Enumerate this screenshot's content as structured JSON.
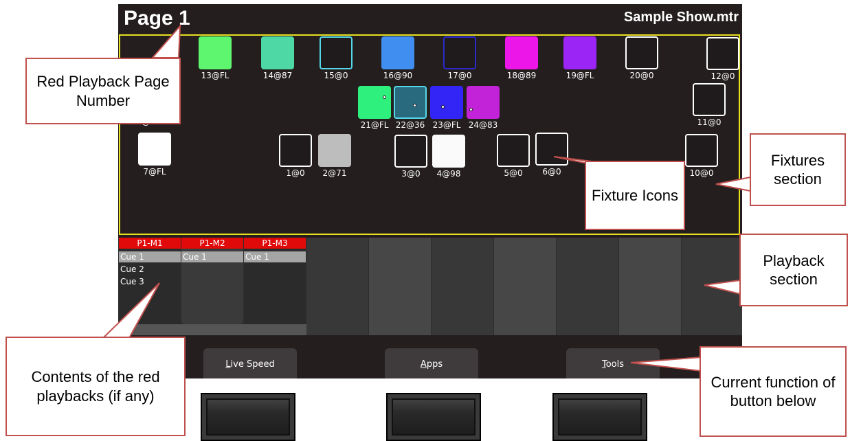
{
  "header": {
    "page_title": "Page 1",
    "show_name": "Sample Show.mtr"
  },
  "fixtures": [
    {
      "label": "13@FL",
      "color": "#5ef56f",
      "outline": false
    },
    {
      "label": "14@87",
      "color": "#4ed8a6",
      "outline": false
    },
    {
      "label": "15@0",
      "color": "#1f1b1c",
      "outline": true,
      "border": "#55d8e8"
    },
    {
      "label": "16@90",
      "color": "#3f8ef0",
      "outline": false
    },
    {
      "label": "17@0",
      "color": "#1f1b1c",
      "outline": true,
      "border": "#2a2acc"
    },
    {
      "label": "18@89",
      "color": "#ec16e8",
      "outline": false
    },
    {
      "label": "19@FL",
      "color": "#9a25f5",
      "outline": false
    },
    {
      "label": "20@0",
      "color": "#1f1b1c",
      "outline": true,
      "border": "#ffffff"
    },
    {
      "label": "12@0",
      "color": "#1f1b1c",
      "outline": true,
      "border": "#ffffff"
    },
    {
      "label": "8@0",
      "color": "#1f1b1c",
      "outline": true,
      "border": "#ffffff"
    },
    {
      "label": "21@FL",
      "color": "#2ef07d",
      "outline": false
    },
    {
      "label": "22@36",
      "color": "#2a6a7e",
      "outline": true,
      "border": "#55d8e8"
    },
    {
      "label": "23@FL",
      "color": "#3325f5",
      "outline": false
    },
    {
      "label": "24@83",
      "color": "#c222d8",
      "outline": false
    },
    {
      "label": "11@0",
      "color": "#1f1b1c",
      "outline": true,
      "border": "#ffffff"
    },
    {
      "label": "7@FL",
      "color": "#ffffff",
      "outline": false
    },
    {
      "label": "1@0",
      "color": "#1f1b1c",
      "outline": true,
      "border": "#ffffff"
    },
    {
      "label": "2@71",
      "color": "#bdbdbd",
      "outline": false
    },
    {
      "label": "3@0",
      "color": "#1f1b1c",
      "outline": true,
      "border": "#ffffff"
    },
    {
      "label": "4@98",
      "color": "#fafafa",
      "outline": false
    },
    {
      "label": "5@0",
      "color": "#1f1b1c",
      "outline": true,
      "border": "#ffffff"
    },
    {
      "label": "6@0",
      "color": "#1f1b1c",
      "outline": true,
      "border": "#ffffff"
    },
    {
      "label": "10@0",
      "color": "#1f1b1c",
      "outline": true,
      "border": "#ffffff"
    }
  ],
  "playbacks": [
    {
      "name": "P1-M1",
      "cues": [
        "Cue 1",
        "Cue 2",
        "Cue 3"
      ]
    },
    {
      "name": "P1-M2",
      "cues": [
        "Cue 1"
      ]
    },
    {
      "name": "P1-M3",
      "cues": [
        "Cue 1"
      ]
    }
  ],
  "softkeys": [
    {
      "label": "Live Speed",
      "underline": "L",
      "rest": "ive Speed"
    },
    {
      "label": "Apps",
      "underline": "A",
      "rest": "pps"
    },
    {
      "label": "Tools",
      "underline": "T",
      "rest": "ools"
    }
  ],
  "callouts": {
    "page_number": "Red Playback Page Number",
    "fixture_icons": "Fixture Icons",
    "fixtures_section": "Fixtures section",
    "playback_section": "Playback section",
    "red_playback_contents": "Contents of the red playbacks (if any)",
    "button_function": "Current function of button below"
  },
  "colors": {
    "screen_bg": "#241e1f",
    "fixture_border": "#e8e020",
    "playback_red": "#e00a0a",
    "callout_border": "#c0504d"
  }
}
